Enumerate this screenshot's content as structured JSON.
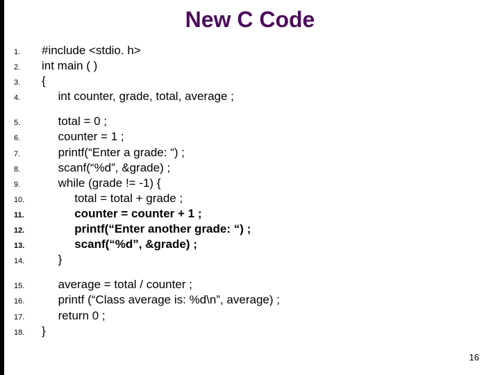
{
  "title": "New C Code",
  "page_number": "16",
  "lines": [
    {
      "n": "1.",
      "c": "#include <stdio. h>"
    },
    {
      "n": "2.",
      "c": "int main ( )"
    },
    {
      "n": "3.",
      "c": "{"
    },
    {
      "n": "4.",
      "c": "     int counter, grade, total, average ;"
    },
    {
      "gap": true
    },
    {
      "n": "5.",
      "c": "     total = 0 ;"
    },
    {
      "n": "6.",
      "c": "     counter = 1 ;"
    },
    {
      "n": "7.",
      "c": "     printf(“Enter a grade: “) ;"
    },
    {
      "n": "8.",
      "c": "     scanf(“%d”, &grade) ;"
    },
    {
      "n": "9.",
      "c": "     while (grade != -1) {"
    },
    {
      "n": "10.",
      "c": "          total = total + grade ;"
    },
    {
      "n": "11.",
      "c": "          counter = counter + 1 ;",
      "bold": true
    },
    {
      "n": "12.",
      "c": "          printf(“Enter another grade: “) ;",
      "bold": true
    },
    {
      "n": "13.",
      "c": "          scanf(“%d”, &grade) ;",
      "bold": true
    },
    {
      "n": "14.",
      "c": "     }"
    },
    {
      "gap": true
    },
    {
      "n": "15.",
      "c": "     average = total / counter ;"
    },
    {
      "n": "16.",
      "c": "     printf (“Class average is: %d\\n”, average) ;"
    },
    {
      "n": "17.",
      "c": "     return 0 ;"
    },
    {
      "n": "18.",
      "c": "}"
    }
  ]
}
